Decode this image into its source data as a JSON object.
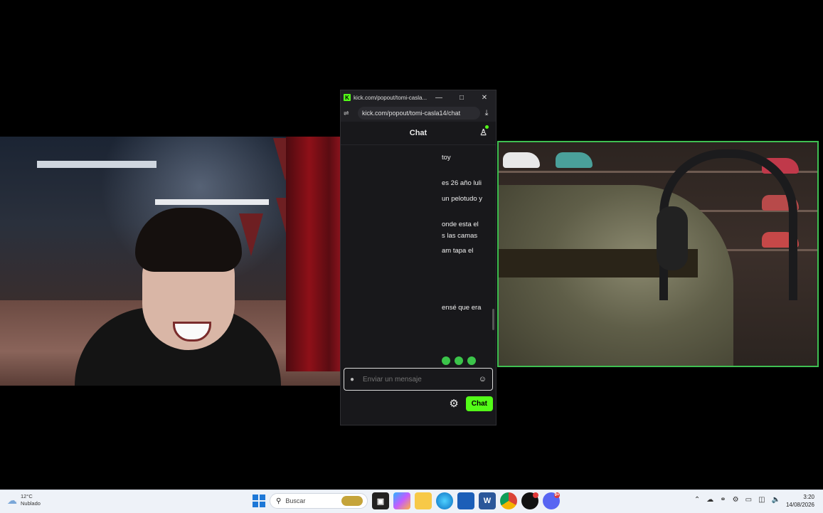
{
  "window": {
    "title": "kick.com/popout/tomi-casla...",
    "url": "kick.com/popout/tomi-casla14/chat"
  },
  "chat": {
    "header_title": "Chat",
    "messages": [
      "toy",
      "es 26 año luli",
      "un pelotudo y",
      "onde esta el",
      "s las camas",
      "am tapa el",
      "ensé que era"
    ],
    "input_placeholder": "Enviar un mensaje",
    "send_label": "Chat"
  },
  "taskbar": {
    "weather_temp": "12°C",
    "weather_desc": "Nublado",
    "search_placeholder": "Buscar",
    "time": "3:20",
    "date": "14/08/2026",
    "discord_badge": "9+"
  },
  "colors": {
    "kick_green": "#53fc18",
    "cam_border": "#3fbf52",
    "chat_bg": "#18181b"
  },
  "icons": [
    "kick-logo-icon",
    "minimize-icon",
    "maximize-icon",
    "close-icon",
    "site-info-icon",
    "download-icon",
    "users-icon",
    "emote-icon",
    "emoji-icon",
    "gear-icon",
    "cloud-icon",
    "windows-start-icon",
    "search-icon",
    "copilot-icon",
    "file-explorer-icon",
    "edge-icon",
    "store-icon",
    "word-icon",
    "chrome-icon",
    "app-icon",
    "discord-icon"
  ]
}
